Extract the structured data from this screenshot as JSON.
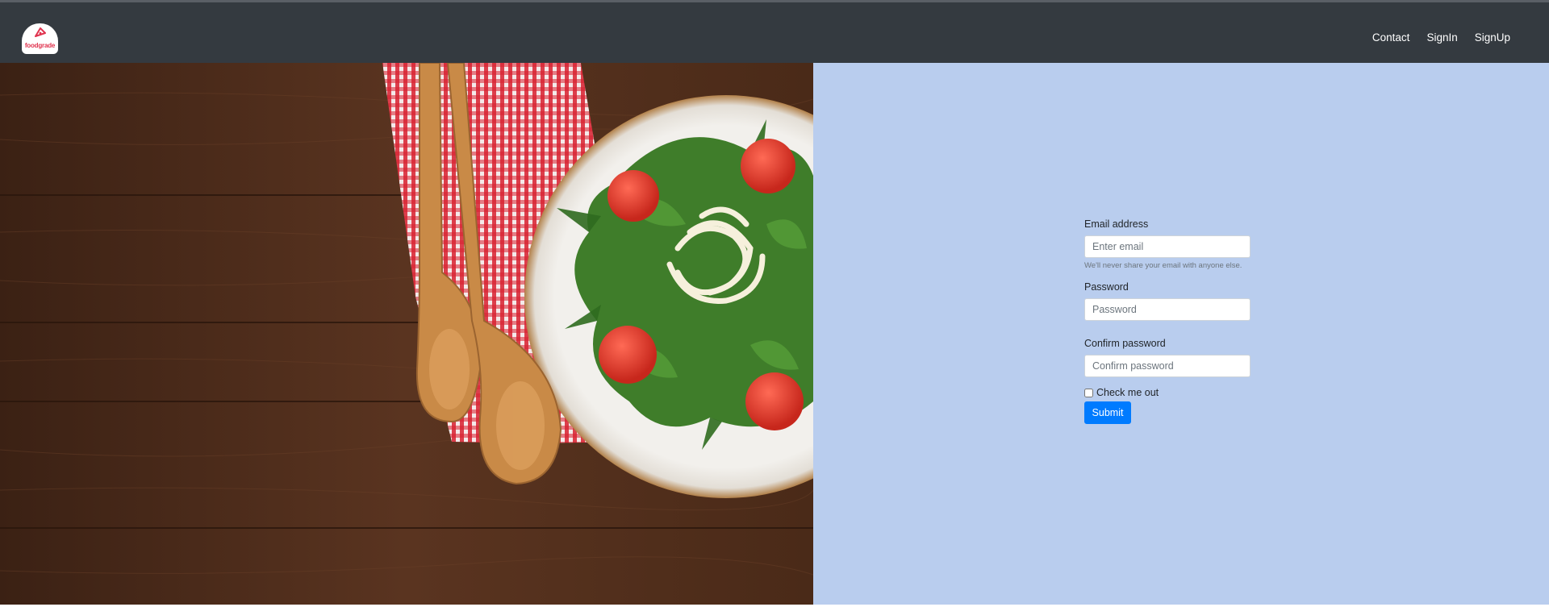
{
  "brand": {
    "logo_text": "foodgrade",
    "accent_color": "#e0344f"
  },
  "nav": {
    "items": [
      {
        "label": "Contact"
      },
      {
        "label": "SignIn"
      },
      {
        "label": "SignUp"
      }
    ]
  },
  "hero": {
    "image_icon": "salad-plate-with-wooden-spoons-icon"
  },
  "form": {
    "email_label": "Email address",
    "email_placeholder": "Enter email",
    "email_help": "We'll never share your email with anyone else.",
    "password_label": "Password",
    "password_placeholder": "Password",
    "confirm_label": "Confirm password",
    "confirm_placeholder": "Confirm password",
    "checkbox_label": "Check me out",
    "checkbox_checked": false,
    "submit_label": "Submit",
    "submit_color": "#007bff",
    "panel_color": "#b9cdee"
  }
}
